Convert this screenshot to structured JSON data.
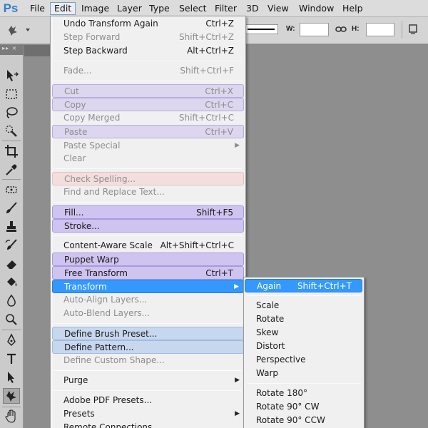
{
  "app": {
    "logo": "Ps",
    "menubar": [
      "File",
      "Edit",
      "Image",
      "Layer",
      "Type",
      "Select",
      "Filter",
      "3D",
      "View",
      "Window",
      "Help"
    ],
    "active_menu": "Edit"
  },
  "options_bar": {
    "w_label": "W:",
    "h_label": "H:",
    "w_value": "",
    "h_value": ""
  },
  "tools": [
    "move-tool",
    "marquee-tool",
    "lasso-tool",
    "quick-selection-tool",
    "crop-tool",
    "eyedropper-tool",
    "spot-healing-tool",
    "brush-tool",
    "clone-stamp-tool",
    "history-brush-tool",
    "eraser-tool",
    "paint-bucket-tool",
    "blur-tool",
    "dodge-tool",
    "pen-tool",
    "type-tool",
    "path-selection-tool",
    "custom-shape-tool",
    "hand-tool"
  ],
  "edit_menu": {
    "items": [
      {
        "label": "Undo Transform Again",
        "shortcut": "Ctrl+Z"
      },
      {
        "label": "Step Forward",
        "shortcut": "Shift+Ctrl+Z"
      },
      {
        "label": "Step Backward",
        "shortcut": "Alt+Ctrl+Z"
      },
      {
        "label": "Fade...",
        "shortcut": "Shift+Ctrl+F"
      },
      {
        "label": "Cut",
        "shortcut": "Ctrl+X"
      },
      {
        "label": "Copy",
        "shortcut": "Ctrl+C"
      },
      {
        "label": "Copy Merged",
        "shortcut": "Shift+Ctrl+C"
      },
      {
        "label": "Paste",
        "shortcut": "Ctrl+V"
      },
      {
        "label": "Paste Special",
        "shortcut": ""
      },
      {
        "label": "Clear",
        "shortcut": ""
      },
      {
        "label": "Check Spelling...",
        "shortcut": ""
      },
      {
        "label": "Find and Replace Text...",
        "shortcut": ""
      },
      {
        "label": "Fill...",
        "shortcut": "Shift+F5"
      },
      {
        "label": "Stroke...",
        "shortcut": ""
      },
      {
        "label": "Content-Aware Scale",
        "shortcut": "Alt+Shift+Ctrl+C"
      },
      {
        "label": "Puppet Warp",
        "shortcut": ""
      },
      {
        "label": "Free Transform",
        "shortcut": "Ctrl+T"
      },
      {
        "label": "Transform",
        "shortcut": ""
      },
      {
        "label": "Auto-Align Layers...",
        "shortcut": ""
      },
      {
        "label": "Auto-Blend Layers...",
        "shortcut": ""
      },
      {
        "label": "Define Brush Preset...",
        "shortcut": ""
      },
      {
        "label": "Define Pattern...",
        "shortcut": ""
      },
      {
        "label": "Define Custom Shape...",
        "shortcut": ""
      },
      {
        "label": "Purge",
        "shortcut": ""
      },
      {
        "label": "Adobe PDF Presets...",
        "shortcut": ""
      },
      {
        "label": "Presets",
        "shortcut": ""
      },
      {
        "label": "Remote Connections...",
        "shortcut": ""
      }
    ]
  },
  "transform_submenu": {
    "items": [
      {
        "label": "Again",
        "shortcut": "Shift+Ctrl+T"
      },
      {
        "label": "Scale",
        "shortcut": ""
      },
      {
        "label": "Rotate",
        "shortcut": ""
      },
      {
        "label": "Skew",
        "shortcut": ""
      },
      {
        "label": "Distort",
        "shortcut": ""
      },
      {
        "label": "Perspective",
        "shortcut": ""
      },
      {
        "label": "Warp",
        "shortcut": ""
      },
      {
        "label": "Rotate 180°",
        "shortcut": ""
      },
      {
        "label": "Rotate 90° CW",
        "shortcut": ""
      },
      {
        "label": "Rotate 90° CCW",
        "shortcut": ""
      }
    ]
  },
  "colors": {
    "active_item": "#3399ff",
    "highlight_purple": "#cfc4f0",
    "highlight_blue": "#c6d7ee",
    "highlight_pink": "#f3dede",
    "logo": "#2f7fd0"
  }
}
